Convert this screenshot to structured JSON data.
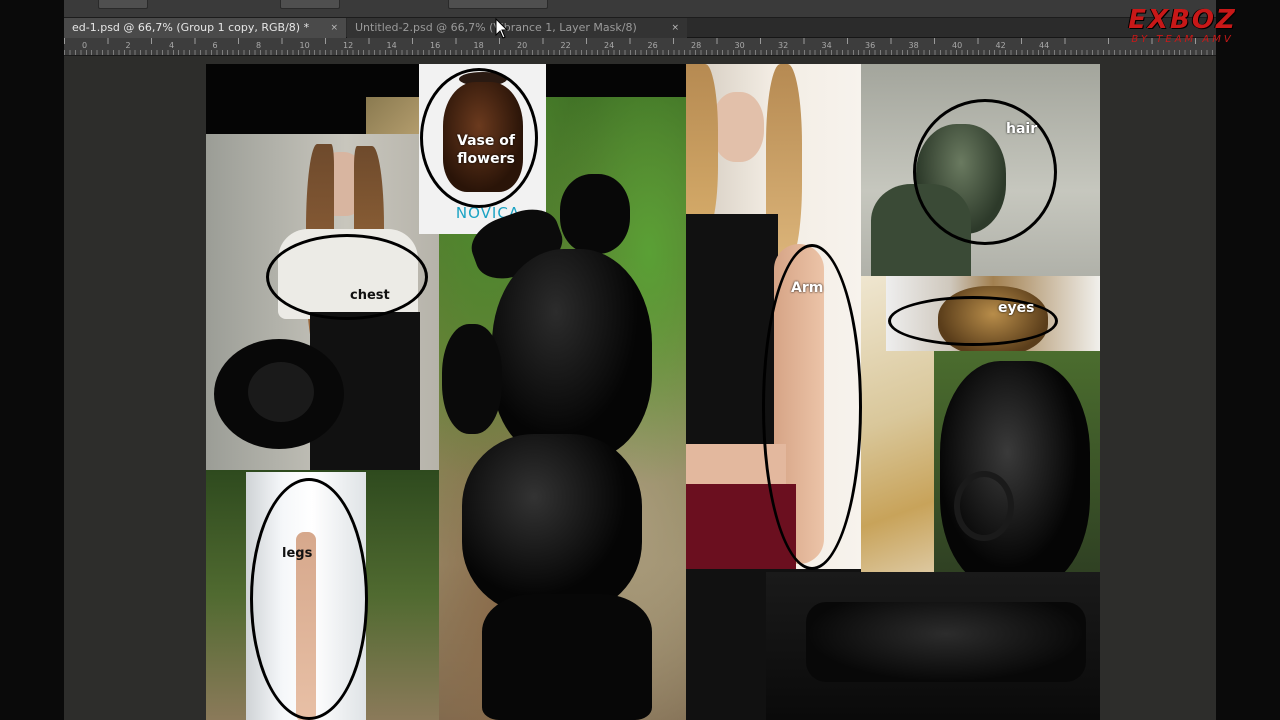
{
  "tabs": [
    {
      "label": "ed-1.psd @ 66,7% (Group 1 copy, RGB/8) *",
      "close": "×",
      "active": true
    },
    {
      "label": "Untitled-2.psd @ 66,7% (Vibrance 1, Layer Mask/8)",
      "close": "×",
      "active": false
    }
  ],
  "ruler_labels": [
    "0",
    "2",
    "4",
    "6",
    "8",
    "10",
    "12",
    "14",
    "16",
    "18",
    "20",
    "22",
    "24",
    "26",
    "28",
    "30",
    "32",
    "34",
    "36",
    "38",
    "40",
    "42",
    "44"
  ],
  "annotations": {
    "vase": "Vase of\nflowers",
    "chest": "chest",
    "legs": "legs",
    "arm": "Arm",
    "hair": "hair",
    "eyes": "eyes"
  },
  "vase_brand": "NOVICA",
  "watermark": {
    "main": "EXBOZ",
    "sub": "BY TEAM AMV"
  },
  "colors": {
    "ui_dark": "#2b2b2b",
    "tab_active": "#4a4a4a",
    "logo_red": "#c81818"
  }
}
